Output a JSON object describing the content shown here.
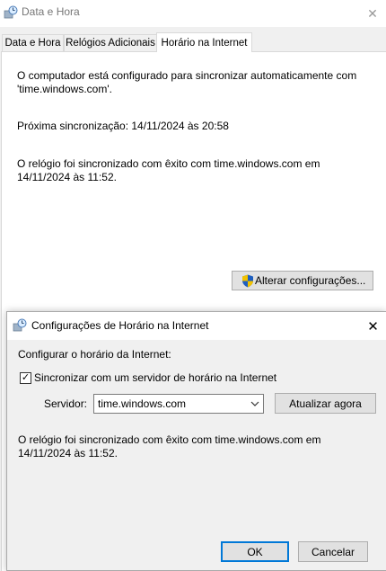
{
  "outer": {
    "title": "Data e Hora",
    "close_glyph": "✕",
    "tabs": [
      {
        "label": "Data e Hora",
        "active": false
      },
      {
        "label": "Relógios Adicionais",
        "active": false
      },
      {
        "label": "Horário na Internet",
        "active": true
      }
    ],
    "panel": {
      "configured_text_1": "O computador está configurado para sincronizar automaticamente com",
      "configured_text_2": "'time.windows.com'.",
      "next_sync": "Próxima sincronização: 14/11/2024 às 20:58",
      "sync_ok_1": "O relógio foi sincronizado com êxito com time.windows.com em",
      "sync_ok_2": "14/11/2024 às 11:52.",
      "change_button": "Alterar configurações..."
    }
  },
  "dialog": {
    "title": "Configurações de Horário na Internet",
    "close_glyph": "✕",
    "section_label": "Configurar o horário da Internet:",
    "sync_checkbox": {
      "label": "Sincronizar com um servidor de horário na Internet",
      "checked": true,
      "check_glyph": "✓"
    },
    "server_label": "Servidor:",
    "server_value": "time.windows.com",
    "update_button": "Atualizar agora",
    "status_1": "O relógio foi sincronizado com êxito com time.windows.com em",
    "status_2": "14/11/2024 às 11:52.",
    "ok_button": "OK",
    "cancel_button": "Cancelar"
  },
  "icons": {
    "window_icon": "clock-globe-icon",
    "shield_icon": "uac-shield-icon",
    "dropdown": "chevron-down-icon"
  },
  "colors": {
    "accent": "#0078d7",
    "window_bg": "#f0f0f0",
    "panel_bg": "#ffffff"
  }
}
